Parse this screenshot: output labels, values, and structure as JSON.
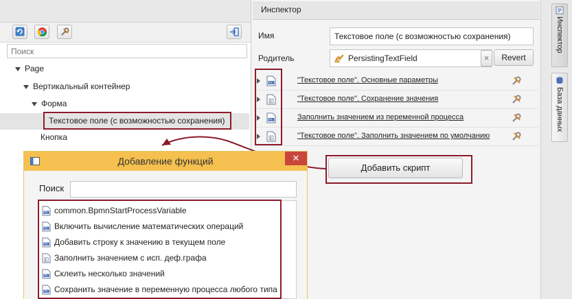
{
  "left": {
    "search_placeholder": "Поиск",
    "tree": [
      {
        "label": "Page"
      },
      {
        "label": "Вертикальный контейнер"
      },
      {
        "label": "Форма"
      },
      {
        "label": "Текстовое поле (с возможностью сохранения)"
      },
      {
        "label": "Кнопка"
      }
    ]
  },
  "inspector": {
    "title": "Инспектор",
    "name_label": "Имя",
    "name_value": "Текстовое поле (с возможностью сохранения)",
    "parent_label": "Родитель",
    "parent_value": "PersistingTextField",
    "parent_clear": "×",
    "revert_label": "Revert",
    "scripts": [
      {
        "label": "\"Текстовое поле\". Основные параметры",
        "icon": "ts-file-icon"
      },
      {
        "label": "\"Текстовое поле\". Сохранение значения",
        "icon": "js-file-icon"
      },
      {
        "label": "Заполнить значением из переменной процесса",
        "icon": "ts-file-icon"
      },
      {
        "label": "\"Текстовое поле\". Заполнить значением по умолчанию",
        "icon": "js-file-icon"
      }
    ],
    "add_script_label": "Добавить скрипт"
  },
  "side_tabs": {
    "inspector": "Инспектор",
    "database": "База данных"
  },
  "dialog": {
    "title": "Добавление функций",
    "close": "✕",
    "search_label": "Поиск",
    "search_value": "",
    "functions": [
      {
        "label": "common.BpmnStartProcessVariable",
        "icon": "ts-file-icon"
      },
      {
        "label": "Включить вычисление математических операций",
        "icon": "ts-file-icon"
      },
      {
        "label": "Добавить строку к значению в текущем поле",
        "icon": "ts-file-icon"
      },
      {
        "label": "Заполнить значением с исп. деф.графа",
        "icon": "js-file-icon"
      },
      {
        "label": "Склеить несколько значений",
        "icon": "ts-file-icon"
      },
      {
        "label": "Сохранить значение в переменную процесса любого типа",
        "icon": "ts-file-icon"
      }
    ]
  },
  "colors": {
    "highlight_border": "#8b1a2a",
    "dialog_title": "#f5c04f",
    "close_button": "#c9463d"
  }
}
